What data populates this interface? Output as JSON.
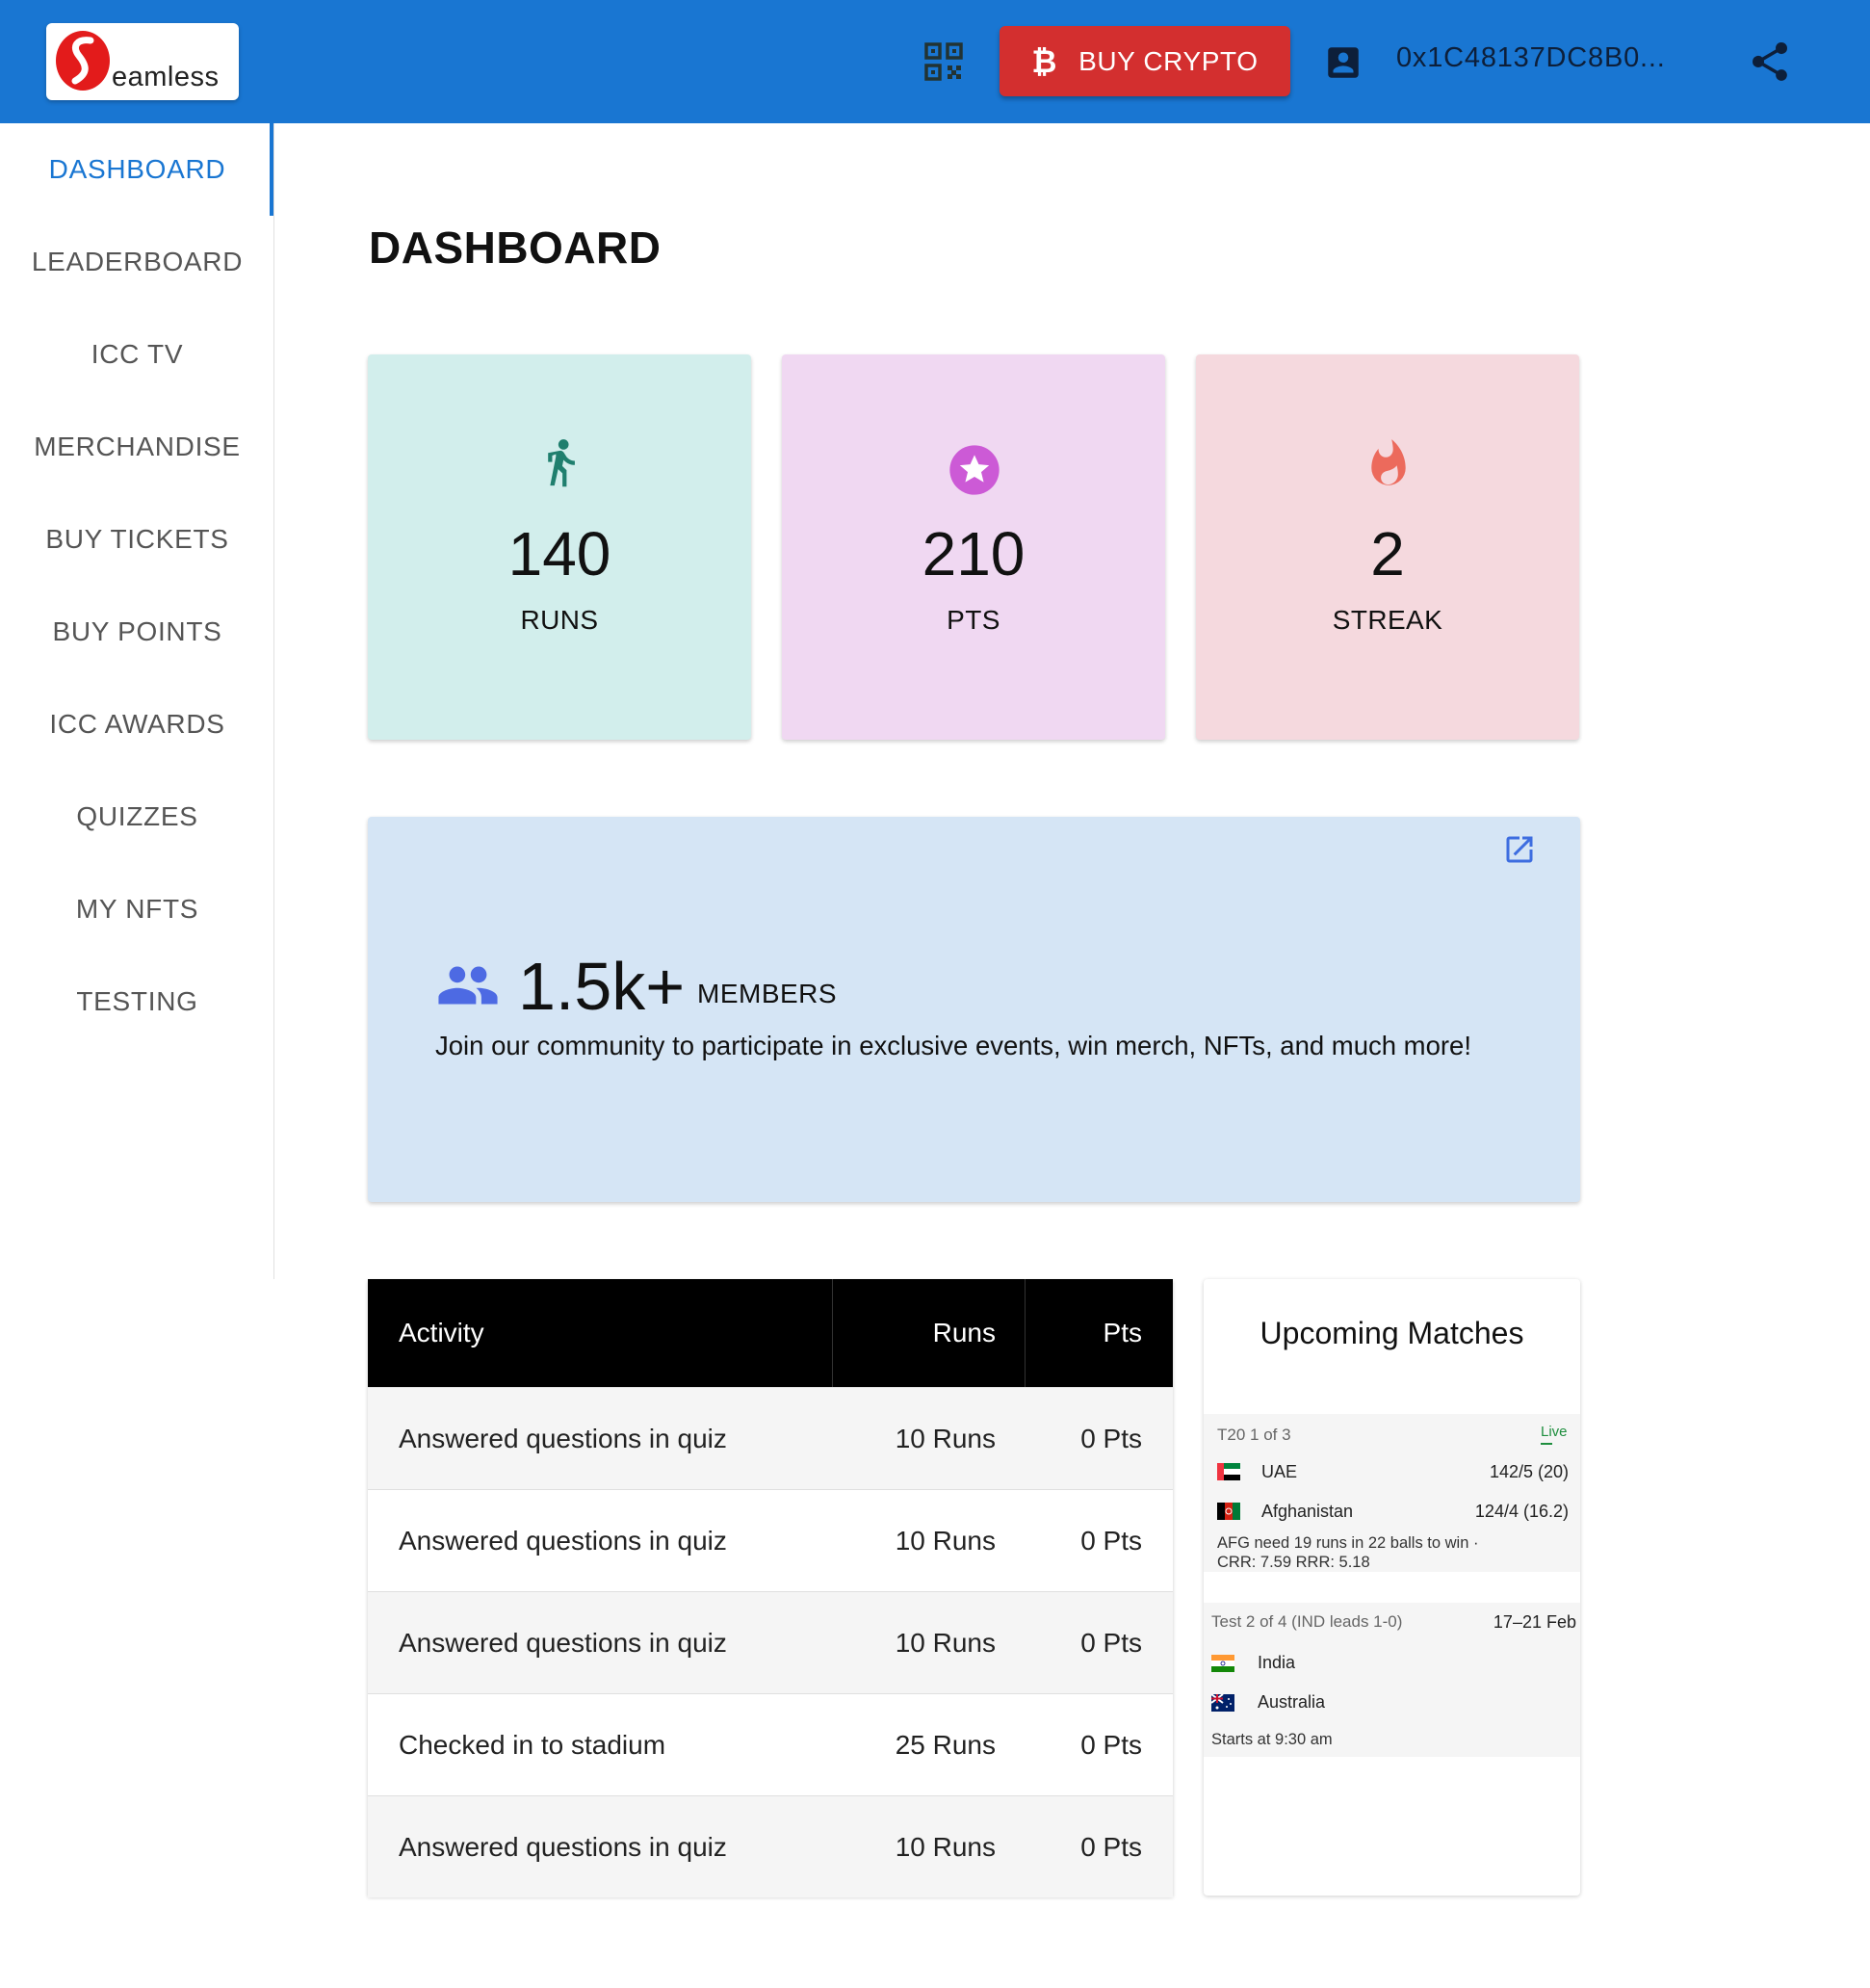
{
  "brand": {
    "logo_text": "eamless"
  },
  "header": {
    "buy_crypto_label": "BUY CRYPTO",
    "wallet_address": "0x1C48137DC8B0...",
    "accent_color": "#1976d2",
    "buy_color": "#d32f2f"
  },
  "sidebar": {
    "items": [
      {
        "label": "DASHBOARD",
        "active": true
      },
      {
        "label": "LEADERBOARD"
      },
      {
        "label": "ICC TV"
      },
      {
        "label": "MERCHANDISE"
      },
      {
        "label": "BUY TICKETS"
      },
      {
        "label": "BUY POINTS"
      },
      {
        "label": "ICC AWARDS"
      },
      {
        "label": "QUIZZES"
      },
      {
        "label": "MY NFTS"
      },
      {
        "label": "TESTING"
      }
    ]
  },
  "page": {
    "title": "DASHBOARD"
  },
  "stats": [
    {
      "value": "140",
      "label": "RUNS",
      "icon": "run-icon",
      "bg": "#d2eeec"
    },
    {
      "value": "210",
      "label": "PTS",
      "icon": "star-circle-icon",
      "bg": "#f0d8f2"
    },
    {
      "value": "2",
      "label": "STREAK",
      "icon": "fire-icon",
      "bg": "#f5d9de"
    }
  ],
  "community": {
    "count": "1.5k+",
    "label": "MEMBERS",
    "description": "Join our community to participate in exclusive events, win merch, NFTs, and much more!"
  },
  "activity_table": {
    "headers": {
      "activity": "Activity",
      "runs": "Runs",
      "pts": "Pts"
    },
    "rows": [
      {
        "activity": "Answered questions in quiz",
        "runs": "10 Runs",
        "pts": "0 Pts"
      },
      {
        "activity": "Answered questions in quiz",
        "runs": "10 Runs",
        "pts": "0 Pts"
      },
      {
        "activity": "Answered questions in quiz",
        "runs": "10 Runs",
        "pts": "0 Pts"
      },
      {
        "activity": "Checked in to stadium",
        "runs": "25 Runs",
        "pts": "0 Pts"
      },
      {
        "activity": "Answered questions in quiz",
        "runs": "10 Runs",
        "pts": "0 Pts"
      }
    ]
  },
  "upcoming": {
    "title": "Upcoming Matches",
    "match1": {
      "meta": "T20 1 of 3",
      "status": "Live",
      "team1": "UAE",
      "score1": "142/5 (20)",
      "team2": "Afghanistan",
      "score2": "124/4 (16.2)",
      "note1": "AFG need 19 runs in 22 balls to win ·",
      "note2": "CRR: 7.59  RRR: 5.18"
    },
    "match2": {
      "meta": "Test 2 of 4 (IND leads 1-0)",
      "dates": "17–21 Feb",
      "team1": "India",
      "team2": "Australia",
      "note": "Starts at 9:30 am"
    }
  }
}
